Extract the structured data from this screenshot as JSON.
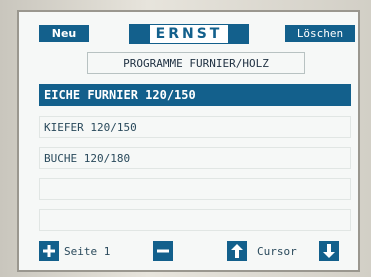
{
  "header": {
    "new_label": "Neu",
    "logo_text": "ERNST",
    "delete_label": "Löschen"
  },
  "title": "PROGRAMME FURNIER/HOLZ",
  "items": [
    {
      "label": "EICHE FURNIER  120/150",
      "selected": true
    },
    {
      "label": "KIEFER 120/150",
      "selected": false
    },
    {
      "label": "BUCHE 120/180",
      "selected": false
    },
    {
      "label": "",
      "selected": false
    },
    {
      "label": "",
      "selected": false
    }
  ],
  "footer": {
    "page_label": "Seite 1",
    "cursor_label": "Cursor"
  },
  "colors": {
    "accent": "#13608c",
    "screen_bg": "#f6f8f7",
    "text": "#2a4a5c"
  },
  "icons": {
    "plus": "plus-icon",
    "minus": "minus-icon",
    "up": "arrow-up-icon",
    "down": "arrow-down-icon"
  }
}
